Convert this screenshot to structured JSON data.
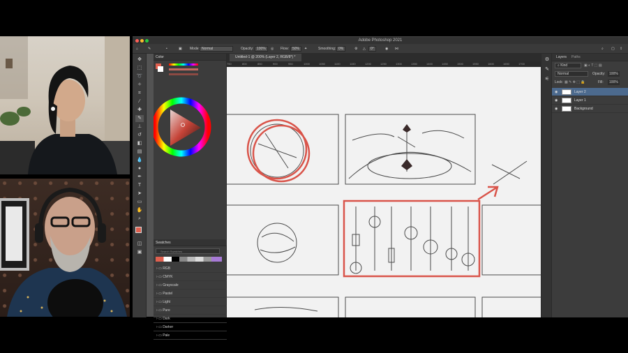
{
  "app": {
    "title": "Adobe Photoshop 2021",
    "document_tab": "Untitled-1 @ 200% (Layer 2, RGB/8*) *"
  },
  "options_bar": {
    "mode_label": "Mode:",
    "mode_value": "Normal",
    "opacity_label": "Opacity:",
    "opacity_value": "100%",
    "flow_label": "Flow:",
    "flow_value": "50%",
    "smoothing_label": "Smoothing:",
    "smoothing_value": "0%",
    "angle_value": "0°"
  },
  "left_panel": {
    "color_tab": "Color",
    "swatches_tab": "Swatches",
    "swatch_search_placeholder": "Search Swatches",
    "swatch_groups": [
      "RGB",
      "CMYK",
      "Grayscale",
      "Pastel",
      "Light",
      "Pure",
      "Dark",
      "Darker",
      "Pale"
    ]
  },
  "ruler": {
    "ticks": [
      "750",
      "800",
      "850",
      "900",
      "950",
      "1000",
      "1050",
      "1100",
      "1150",
      "1200",
      "1250",
      "1300",
      "1350",
      "1400",
      "1450",
      "1500",
      "1550",
      "1600",
      "1650",
      "1700"
    ]
  },
  "right_panel": {
    "layers_tab": "Layers",
    "paths_tab": "Paths",
    "kind_filter": "Kind",
    "blend_mode": "Normal",
    "opacity_label": "Opacity:",
    "opacity_value": "100%",
    "lock_label": "Lock:",
    "fill_label": "Fill:",
    "fill_value": "100%",
    "layers": [
      "Layer 2",
      "Layer 1",
      "Background"
    ]
  },
  "colors": {
    "foreground": "#e0604f",
    "accent_red": "#d9544a",
    "selected_layer": "#4c6a8e"
  }
}
